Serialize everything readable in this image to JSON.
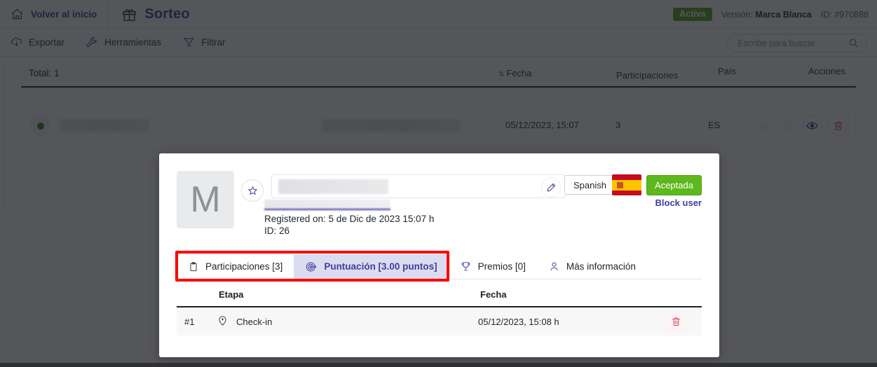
{
  "topbar": {
    "home_label": "Volver al inicio",
    "brand_label": "Sorteo",
    "status_badge": "Activa",
    "version_prefix": "Versión: ",
    "version_value": "Marca Blanca",
    "id_text": "ID: #970888"
  },
  "toolbar": {
    "export_label": "Exportar",
    "tools_label": "Herramientas",
    "filter_label": "Filtrar",
    "search_placeholder": "Escribe para buscar"
  },
  "table": {
    "total_label": "Total: 1",
    "columns": {
      "fecha": "Fecha",
      "participaciones": "Participaciones",
      "pais": "País",
      "acciones": "Acciones"
    },
    "sort_glyph": "⇅",
    "rows": [
      {
        "fecha": "05/12/2023, 15:07",
        "participaciones": "3",
        "pais": "ES"
      }
    ]
  },
  "modal": {
    "avatar_letter": "M",
    "registered_text": "Registered on: 5 de Dic de 2023 15:07 h",
    "id_text": "ID: 26",
    "language_button": "Spanish",
    "accept_button": "Aceptada",
    "block_user_link": "Block user",
    "tabs": [
      {
        "label": "Participaciones [3]",
        "icon": "clipboard-icon",
        "active": false
      },
      {
        "label": "Puntuación [3.00 puntos]",
        "icon": "target-icon",
        "active": true
      },
      {
        "label": "Premios [0]",
        "icon": "trophy-icon",
        "active": false
      },
      {
        "label": "Más información",
        "icon": "user-icon",
        "active": false
      }
    ],
    "sub_table": {
      "columns": {
        "etapa": "Etapa",
        "fecha": "Fecha"
      },
      "rows": [
        {
          "index": "#1",
          "etapa": "Check-in",
          "fecha": "05/12/2023, 15:08 h"
        }
      ]
    }
  },
  "colors": {
    "brand_purple": "#3f3d9e",
    "accept_green": "#5cb81b",
    "status_green": "#2f7d1f",
    "danger_red": "#d9445f",
    "highlight_red": "#ff0000",
    "active_tab_bg": "#dcdcf0"
  }
}
